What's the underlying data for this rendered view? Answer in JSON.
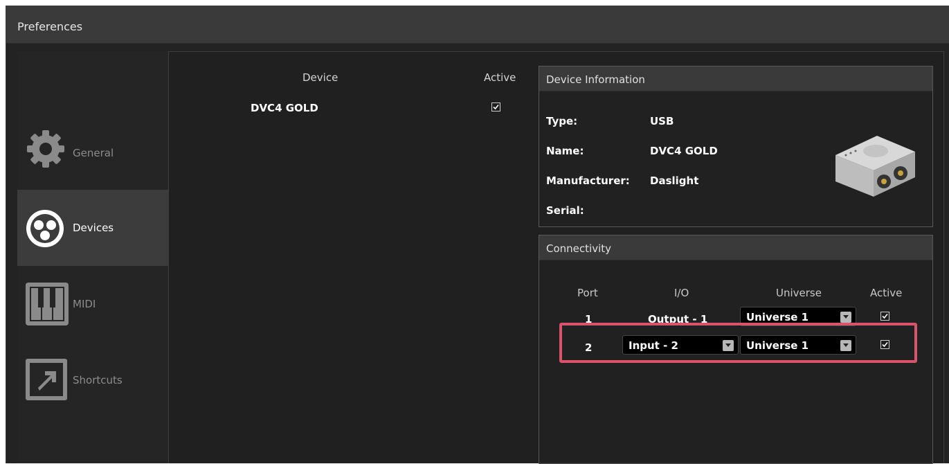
{
  "window": {
    "title": "Preferences"
  },
  "sidebar": {
    "items": [
      {
        "label": "General",
        "icon": "gear-icon",
        "active": false
      },
      {
        "label": "Devices",
        "icon": "dmx-connector-icon",
        "active": true
      },
      {
        "label": "MIDI",
        "icon": "piano-keys-icon",
        "active": false
      },
      {
        "label": "Shortcuts",
        "icon": "shortcut-arrow-icon",
        "active": false
      }
    ]
  },
  "devices": {
    "header_device": "Device",
    "header_active": "Active",
    "rows": [
      {
        "name": "DVC4 GOLD",
        "active": true
      }
    ]
  },
  "device_info": {
    "title": "Device Information",
    "type_label": "Type:",
    "type_value": "USB",
    "name_label": "Name:",
    "name_value": "DVC4 GOLD",
    "manufacturer_label": "Manufacturer:",
    "manufacturer_value": "Daslight",
    "serial_label": "Serial:",
    "serial_value": ""
  },
  "connectivity": {
    "title": "Connectivity",
    "headers": {
      "port": "Port",
      "io": "I/O",
      "universe": "Universe",
      "active": "Active"
    },
    "rows": [
      {
        "port": "1",
        "io": "Output - 1",
        "io_is_dropdown": false,
        "universe": "Universe 1",
        "active": true
      },
      {
        "port": "2",
        "io": "Input - 2",
        "io_is_dropdown": true,
        "universe": "Universe 1",
        "active": true
      }
    ]
  },
  "colors": {
    "highlight": "#d9536b",
    "panel_bg": "#202020",
    "title_bg": "#3a3a3a"
  }
}
